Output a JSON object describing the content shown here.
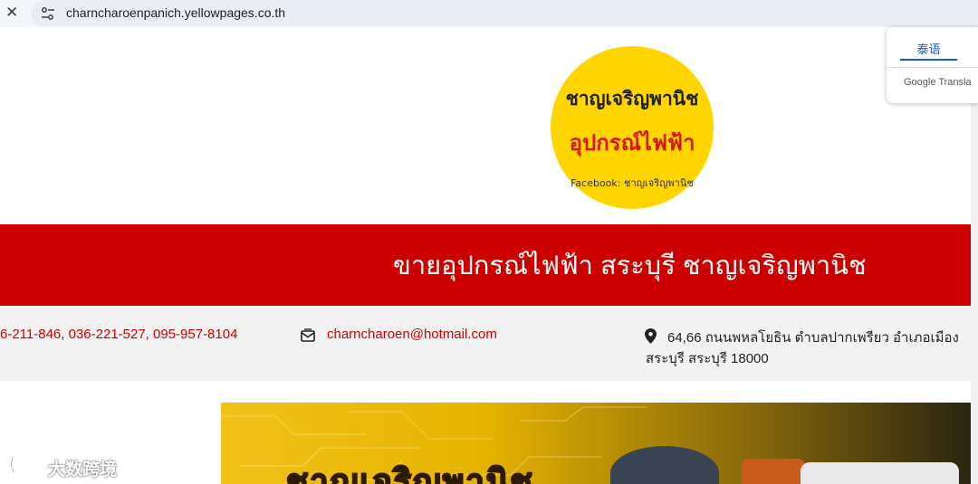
{
  "browser": {
    "url": "charncharoenpanich.yellowpages.co.th",
    "close_icon": "close-icon",
    "site_info_icon": "tune-icon"
  },
  "logo": {
    "line1": "ชาญเจริญพานิช",
    "line2": "อุปกรณ์ไฟฟ้า",
    "line3": "Facebook: ชาญเจริญพานิช",
    "bg_color": "#ffd500"
  },
  "banner": {
    "title": "ขายอุปกรณ์ไฟฟ้า สระบุรี ชาญเจริญพานิช",
    "bg_color": "#cc0000"
  },
  "contact": {
    "phones": "6-211-846, 036-221-527, 095-957-8104",
    "email": "charncharoen@hotmail.com",
    "address_line1": "64,66 ถนนพหลโยธิน ตำบลปากเพรียว อำเภอเมือง",
    "address_line2": "สระบุรี สระบุรี 18000"
  },
  "hero": {
    "text": "ชาญเจริญพานิช"
  },
  "translate": {
    "language_tab": "泰语",
    "brand": "Google Transla"
  },
  "watermark": {
    "text": "大数跨境"
  }
}
